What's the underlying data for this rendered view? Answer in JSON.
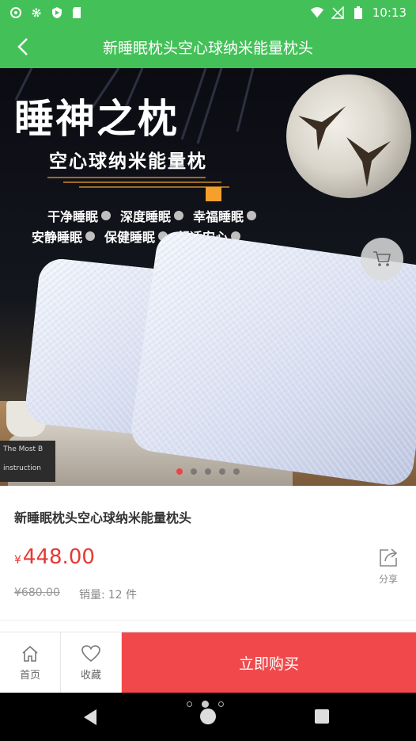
{
  "status_bar": {
    "time": "10:13",
    "left_icons": [
      "cast-icon",
      "gear-icon",
      "shield-icon",
      "sd-card-icon"
    ],
    "right_icons": [
      "wifi-icon",
      "no-signal-icon",
      "battery-icon"
    ]
  },
  "header": {
    "title": "新睡眠枕头空心球纳米能量枕头"
  },
  "banner": {
    "title": "睡神之枕",
    "subtitle": "空心球纳米能量枕",
    "features_row1": [
      "干净睡眠",
      "深度睡眠",
      "幸福睡眠"
    ],
    "features_row2": [
      "安静睡眠",
      "保健睡眠",
      "舒适安心"
    ],
    "book_text": "The Most B",
    "book_text2": "instruction",
    "slide_count": 5,
    "active_slide": 0
  },
  "product": {
    "name": "新睡眠枕头空心球纳米能量枕头",
    "currency": "¥",
    "price": "448.00",
    "original_price": "¥680.00",
    "sales_label": "销量:",
    "sales_value": "12 件",
    "share_label": "分享"
  },
  "action_bar": {
    "home_label": "首页",
    "favorite_label": "收藏",
    "buy_label": "立即购买"
  },
  "colors": {
    "accent_green": "#43c158",
    "price_red": "#e53935",
    "buy_red": "#f1494b"
  }
}
